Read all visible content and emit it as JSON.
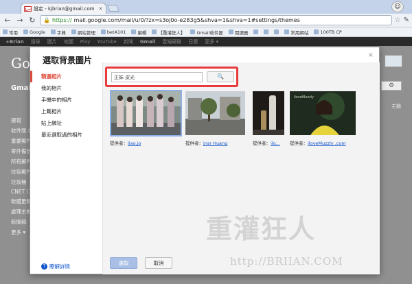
{
  "browser": {
    "tab_title": "設定 - kjbrian@gmail.com",
    "tab_close": "×",
    "url_scheme": "https://",
    "url_rest": "mail.google.com/mail/u/0/?zx=s3oj0o-e283g5&shva=1&shva=1#settings/themes",
    "bookmarks": [
      "常用",
      "Google",
      "字典",
      "網站管理",
      "betA101",
      "編輯",
      "【重灌狂人】",
      "Gmail收件匣",
      "閱讀器",
      "",
      "",
      "",
      "常用網站",
      "100TB CP"
    ]
  },
  "gmail": {
    "gbar": [
      "+Brian",
      "搜尋",
      "圖片",
      "地圖",
      "Play",
      "YouTube",
      "新聞",
      "Gmail",
      "雲端硬碟",
      "日曆",
      "更多 ▾"
    ],
    "logo": "Goog",
    "label": "Gmail ▾",
    "folders": [
      "撰寫",
      "收件匣 (3",
      "重要郵件",
      "寄件備份",
      "所有郵件",
      "垃圾郵件",
      "垃圾桶",
      "CNET (28",
      "軟體更新",
      "處理主機",
      "新聞稿",
      "更多 ▾"
    ],
    "right_tab": "主題"
  },
  "dialog": {
    "title": "選取背景圖片",
    "close": "×",
    "menu": [
      "精選相片",
      "我的相片",
      "手機中的相片",
      "上載相片",
      "貼上網址",
      "最近選取過的相片"
    ],
    "search_value": "正妹 皮光",
    "search_button": "🔍",
    "photos": [
      {
        "provider_label": "提供者：",
        "provider": "liao.jo"
      },
      {
        "provider_label": "提供者：",
        "provider": "jnsr Huang"
      },
      {
        "provider_label": "提供者：",
        "provider": "ilo..."
      },
      {
        "provider_label": "提供者：",
        "provider": "iloveMuzzly .com"
      }
    ],
    "select_button": "選取",
    "cancel_button": "取消",
    "learn_more": "瞭解詳情"
  },
  "watermark": {
    "title": "重灌狂人",
    "url": "http://BRIIAN.COM"
  }
}
